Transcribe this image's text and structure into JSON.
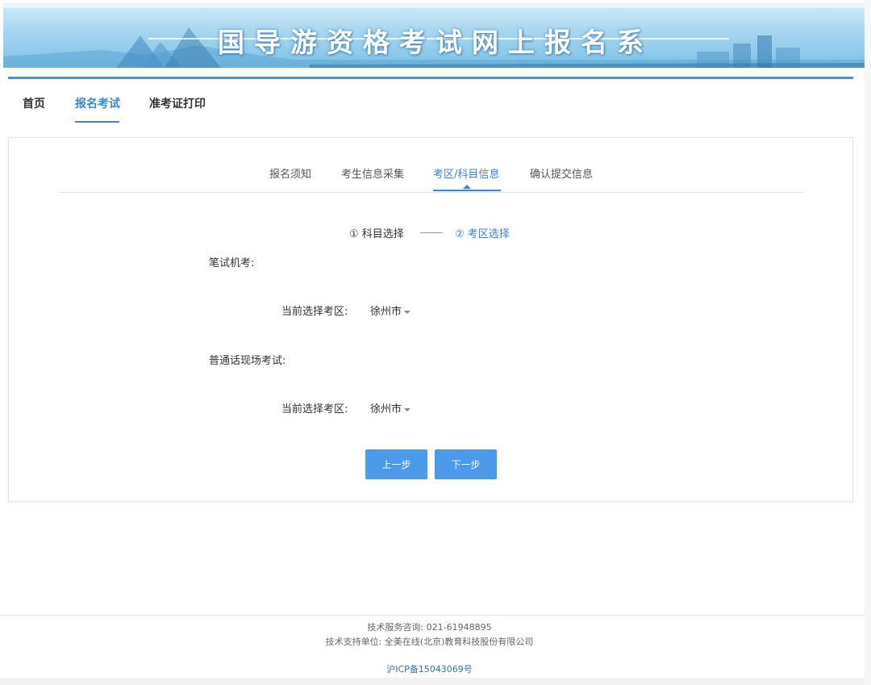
{
  "banner": {
    "title": "国导游资格考试网上报名系"
  },
  "main_nav": {
    "items": [
      "首页",
      "报名考试",
      "准考证打印"
    ],
    "active_index": 1
  },
  "step_tabs": {
    "items": [
      "报名须知",
      "考生信息采集",
      "考区/科目信息",
      "确认提交信息"
    ],
    "active_index": 2
  },
  "substeps": {
    "step1": "① 科目选择",
    "step2": "② 考区选择"
  },
  "sections": [
    {
      "title": "笔试机考:",
      "field_label": "当前选择考区:",
      "selected_value": "徐州市"
    },
    {
      "title": "普通话现场考试:",
      "field_label": "当前选择考区:",
      "selected_value": "徐州市"
    }
  ],
  "buttons": {
    "prev": "上一步",
    "next": "下一步"
  },
  "footer": {
    "service": "技术服务咨询: 021-61948895",
    "support": "技术支持单位: 全美在线(北京)教育科技股份有限公司",
    "icp": "沪ICP备15043069号"
  },
  "colors": {
    "accent": "#3a86d6",
    "button": "#4b9bea",
    "banner": "#a6d6f0"
  }
}
